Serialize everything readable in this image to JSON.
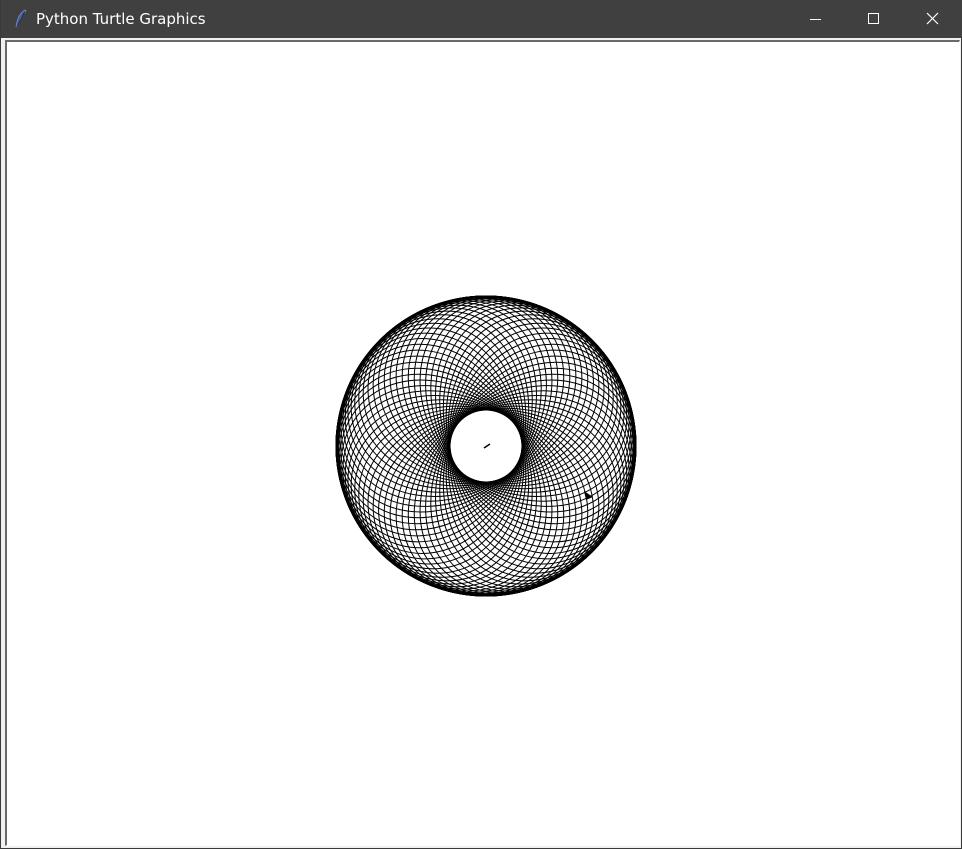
{
  "window": {
    "title": "Python Turtle Graphics",
    "icon": "feather-icon",
    "controls": {
      "minimize_icon": "minimize-icon",
      "maximize_icon": "maximize-icon",
      "close_icon": "close-icon"
    }
  },
  "canvas": {
    "background": "#ffffff",
    "pen_color": "#000000",
    "pattern": "spirograph-rotated-ellipses"
  },
  "colors": {
    "titlebar": "#404040",
    "title_text": "#ffffff",
    "frame": "#f0f0f0"
  }
}
